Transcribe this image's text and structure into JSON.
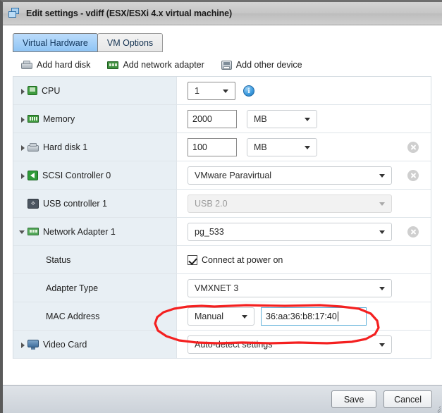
{
  "window": {
    "title": "Edit settings - vdiff (ESX/ESXi 4.x virtual machine)",
    "icon": "windows-cascade-icon"
  },
  "tabs": [
    {
      "label": "Virtual Hardware",
      "active": true
    },
    {
      "label": "VM Options",
      "active": false
    }
  ],
  "toolbar": [
    {
      "label": "Add hard disk",
      "icon": "hard-disk-icon"
    },
    {
      "label": "Add network adapter",
      "icon": "network-adapter-icon"
    },
    {
      "label": "Add other device",
      "icon": "other-device-icon"
    }
  ],
  "rows": [
    {
      "label": "CPU",
      "icon": "cpu-icon",
      "twisty": "collapsed",
      "control": "select",
      "value": "1",
      "info_icon": "info-icon",
      "removable": false
    },
    {
      "label": "Memory",
      "icon": "memory-icon",
      "twisty": "collapsed",
      "control": "text-and-unit",
      "value": "2000",
      "unit": "MB",
      "removable": false
    },
    {
      "label": "Hard disk 1",
      "icon": "hard-disk-icon",
      "twisty": "collapsed",
      "control": "text-and-unit",
      "value": "100",
      "unit": "MB",
      "removable": true
    },
    {
      "label": "SCSI Controller 0",
      "icon": "scsi-controller-icon",
      "twisty": "collapsed",
      "control": "wide-select",
      "value": "VMware Paravirtual",
      "removable": true
    },
    {
      "label": "USB controller 1",
      "icon": "usb-controller-icon",
      "twisty": "none",
      "control": "wide-select-disabled",
      "value": "USB 2.0",
      "removable": false
    },
    {
      "label": "Network Adapter 1",
      "icon": "network-adapter-icon",
      "twisty": "expanded",
      "control": "wide-select",
      "value": "pg_533",
      "removable": true
    },
    {
      "label": "Status",
      "icon": "none",
      "twisty": "none",
      "sub": true,
      "control": "checkbox",
      "checkbox_label": "Connect at power on",
      "checked": true,
      "removable": false
    },
    {
      "label": "Adapter Type",
      "icon": "none",
      "twisty": "none",
      "sub": true,
      "control": "wide-select",
      "value": "VMXNET 3",
      "removable": false
    },
    {
      "label": "MAC Address",
      "icon": "none",
      "twisty": "none",
      "sub": true,
      "control": "mac",
      "mode": "Manual",
      "value": "36:aa:36:b8:17:40",
      "removable": false,
      "annotated": true
    },
    {
      "label": "Video Card",
      "icon": "video-card-icon",
      "twisty": "collapsed",
      "control": "wide-select",
      "value": "Auto-detect settings",
      "removable": false
    }
  ],
  "footer": {
    "save_label": "Save",
    "cancel_label": "Cancel"
  },
  "colors": {
    "annotation_red": "#f42020",
    "focus_blue": "#5eb0d8",
    "active_tab": "#8ec4f4",
    "row_label_bg": "#e8eff4"
  }
}
